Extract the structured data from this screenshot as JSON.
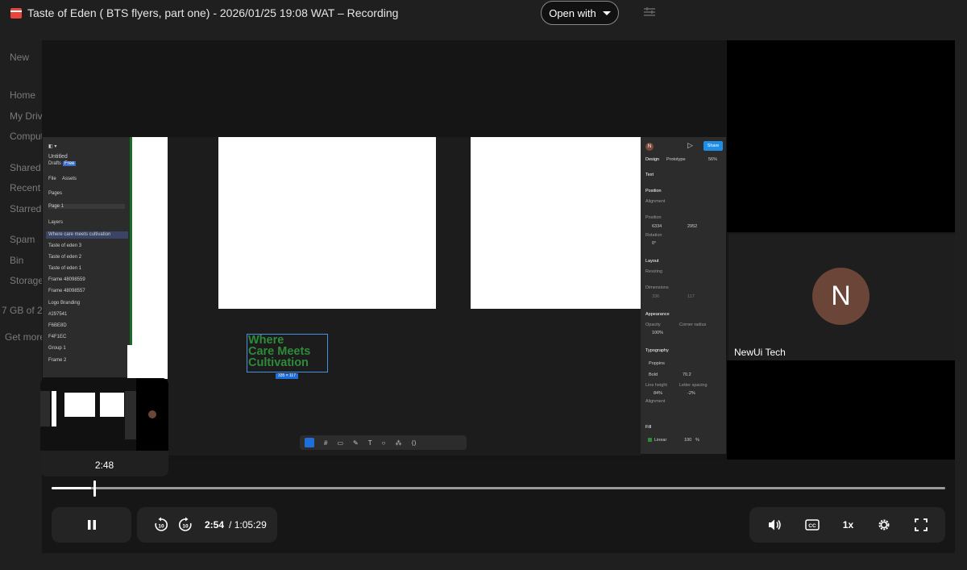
{
  "window": {
    "title": "Taste of Eden ( BTS flyers, part one) - 2026/01/25 19:08 WAT – Recording",
    "open_with_label": "Open with"
  },
  "drive_background": {
    "sidebar_items": [
      "New",
      "Home",
      "My Drive",
      "Computers",
      "Shared",
      "Recent",
      "Starred",
      "Spam",
      "Bin",
      "Storage",
      "7 GB of 2",
      "Get more"
    ]
  },
  "figma": {
    "file_name": "Untitled",
    "drafts_label": "Drafts",
    "plan_badge": "Free",
    "tabs": [
      "File",
      "Assets"
    ],
    "pages_label": "Pages",
    "page_item": "Page 1",
    "layers_label": "Layers",
    "layers": [
      "Where care meets cultivation",
      "Taste of eden 3",
      "Taste of eden 2",
      "Taste of eden 1",
      "Frame 48098559",
      "Frame 48098557",
      "Logo Branding",
      "#297541",
      "F6BE8D",
      "F4F1EC",
      "Group 1",
      "Frame 2"
    ],
    "canvas_text": [
      "Where",
      "Care Meets",
      "Cultivation"
    ],
    "selection_size": "335 × 117",
    "right_panel": {
      "share_label": "Share",
      "tabs": [
        "Design",
        "Prototype"
      ],
      "zoom": "56%",
      "section_text": "Text",
      "section_position": "Position",
      "alignment_label": "Alignment",
      "position_label": "Position",
      "x_value": "6334",
      "y_value": "2952",
      "rotation_label": "Rotation",
      "rotation_value": "0°",
      "section_layout": "Layout",
      "resizing_label": "Resizing",
      "dimensions_label": "Dimensions",
      "w_value": "336",
      "h_value": "117",
      "section_appearance": "Appearance",
      "opacity_label": "Opacity",
      "opacity_value": "100%",
      "corner_label": "Corner radius",
      "section_typography": "Typography",
      "font_family": "Poppins",
      "font_weight": "Bold",
      "font_size": "70.2",
      "line_height_label": "Line height",
      "line_height_value": "84%",
      "letter_spacing_label": "Letter spacing",
      "letter_spacing_value": "-2%",
      "alignment2_label": "Alignment",
      "section_fill": "Fill",
      "fill_type": "Linear",
      "fill_opacity": "100",
      "fill_unit": "%"
    }
  },
  "participant": {
    "initial": "N",
    "name": "NewUi Tech"
  },
  "player": {
    "hover_time": "2:48",
    "current_time": "2:54",
    "duration": "/ 1:05:29",
    "progress_fraction": 0.0443,
    "speed_label": "1x",
    "rewind_label": "10",
    "forward_label": "10"
  }
}
